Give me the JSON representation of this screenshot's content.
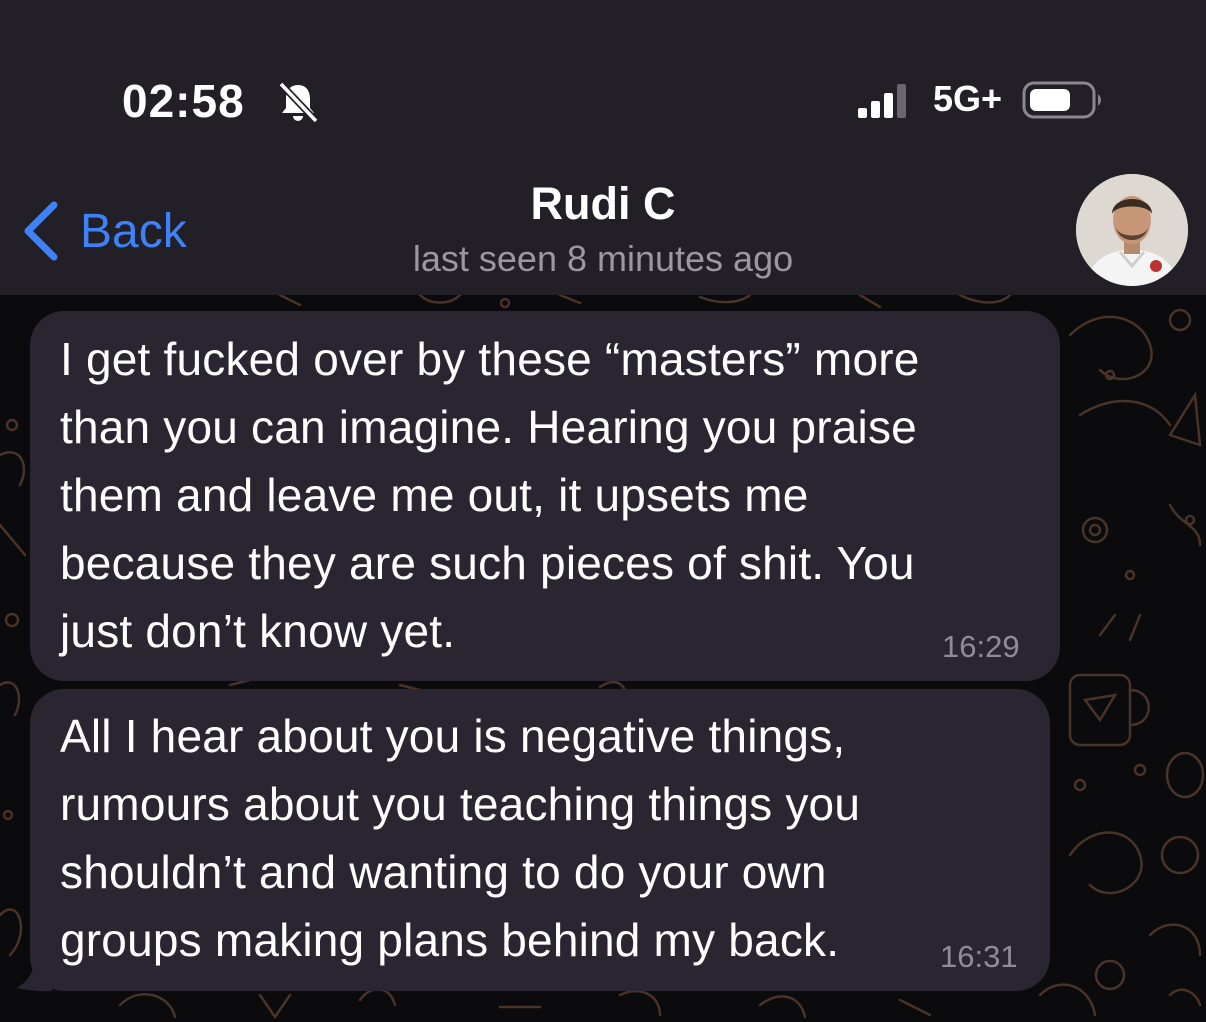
{
  "status_bar": {
    "time": "02:58",
    "network": "5G+"
  },
  "icons": {
    "silent": "bell-slash-icon",
    "signal": "cellular-signal-icon",
    "battery": "battery-icon",
    "back": "chevron-left-icon"
  },
  "header": {
    "back_label": "Back",
    "contact_name": "Rudi C",
    "last_seen": "last seen 8 minutes ago"
  },
  "colors": {
    "accent": "#3f82f7",
    "bubble": "#2a2530",
    "header_bg": "#221f27",
    "chat_bg": "#0b0a0c",
    "timestamp": "#8f8c95"
  },
  "messages": [
    {
      "lines": [
        "I get fucked over by these “masters” more",
        "than you can imagine. Hearing you praise",
        "them and leave me out, it upsets me",
        "because they are such pieces of shit. You",
        "just don’t know yet."
      ],
      "time": "16:29"
    },
    {
      "lines": [
        "All I hear about you is negative things,",
        "rumours about you teaching things you",
        "shouldn’t and wanting to do your own",
        "groups making plans behind my back."
      ],
      "time": "16:31"
    }
  ]
}
